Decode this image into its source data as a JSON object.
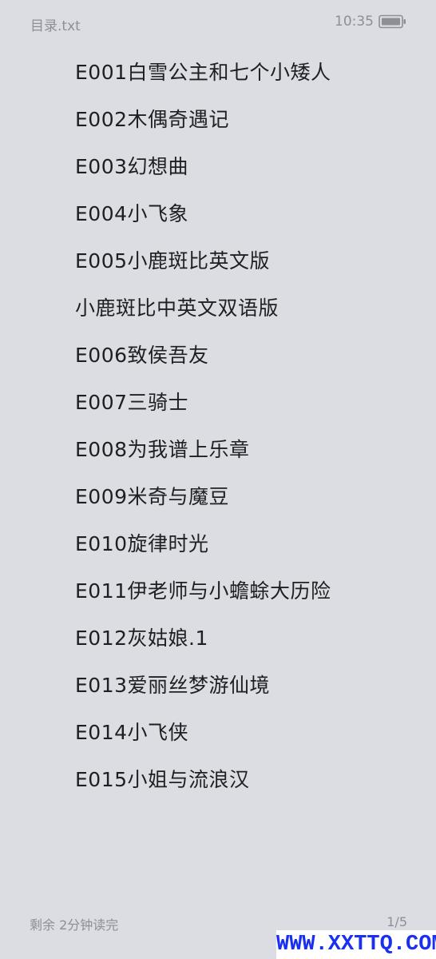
{
  "status_bar": {
    "file_name": "目录.txt",
    "time": "10:35",
    "battery_icon": "battery-icon"
  },
  "toc": {
    "items": [
      "E001白雪公主和七个小矮人",
      "E002木偶奇遇记",
      "E003幻想曲",
      "E004小飞象",
      "E005小鹿斑比英文版",
      "小鹿斑比中英文双语版",
      "E006致侯吾友",
      "E007三骑士",
      "E008为我谱上乐章",
      "E009米奇与魔豆",
      "E010旋律时光",
      "E011伊老师与小蟾蜍大历险",
      "E012灰姑娘.1",
      "E013爱丽丝梦游仙境",
      "E014小飞侠",
      "E015小姐与流浪汉"
    ]
  },
  "footer": {
    "reading_time": "剩余 2分钟读完",
    "page_indicator": "1/5"
  },
  "watermark": {
    "text": "WWW.XXTTQ.COM"
  },
  "colors": {
    "background": "#dcdde2",
    "text": "#1e1f22",
    "muted": "#8d8f97",
    "watermark": "#1a2ff0"
  }
}
